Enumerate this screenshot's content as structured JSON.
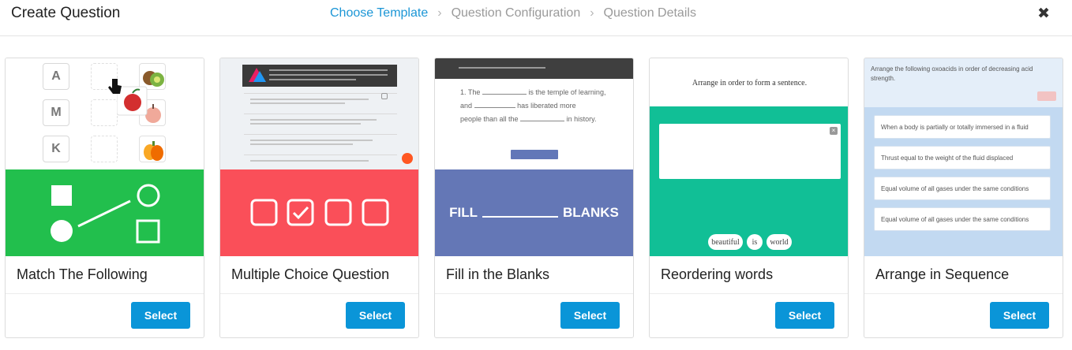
{
  "header": {
    "title": "Create Question",
    "steps": [
      "Choose Template",
      "Question Configuration",
      "Question Details"
    ],
    "close_icon": "close-icon"
  },
  "cards": [
    {
      "title": "Match The Following",
      "select_label": "Select",
      "letters": [
        "A",
        "M",
        "K"
      ],
      "banner_color": "#22bf4d"
    },
    {
      "title": "Multiple Choice Question",
      "select_label": "Select",
      "banner_color": "#fa4f59"
    },
    {
      "title": "Fill in the Blanks",
      "select_label": "Select",
      "banner_text_left": "FILL",
      "banner_text_right": "BLANKS",
      "preview_line1_a": "1. The",
      "preview_line1_b": "is the temple of learning,",
      "preview_line2_a": "and",
      "preview_line2_b": "has liberated more",
      "preview_line3_a": "people than all the",
      "preview_line3_b": "in history.",
      "banner_color": "#6477b6"
    },
    {
      "title": "Reordering words",
      "select_label": "Select",
      "preview_heading": "Arrange in order to form a sentence.",
      "chips": [
        "beautiful",
        "is",
        "world"
      ],
      "banner_color": "#11bf96"
    },
    {
      "title": "Arrange in Sequence",
      "select_label": "Select",
      "preview_heading": "Arrange the following oxoacids in order of decreasing acid strength.",
      "items": [
        "When a body is partially or totally immersed in a fluid",
        "Thrust equal to the weight of the fluid displaced",
        "Equal volume of all gases under the same conditions",
        "Equal volume of all gases under the same conditions"
      ]
    }
  ]
}
